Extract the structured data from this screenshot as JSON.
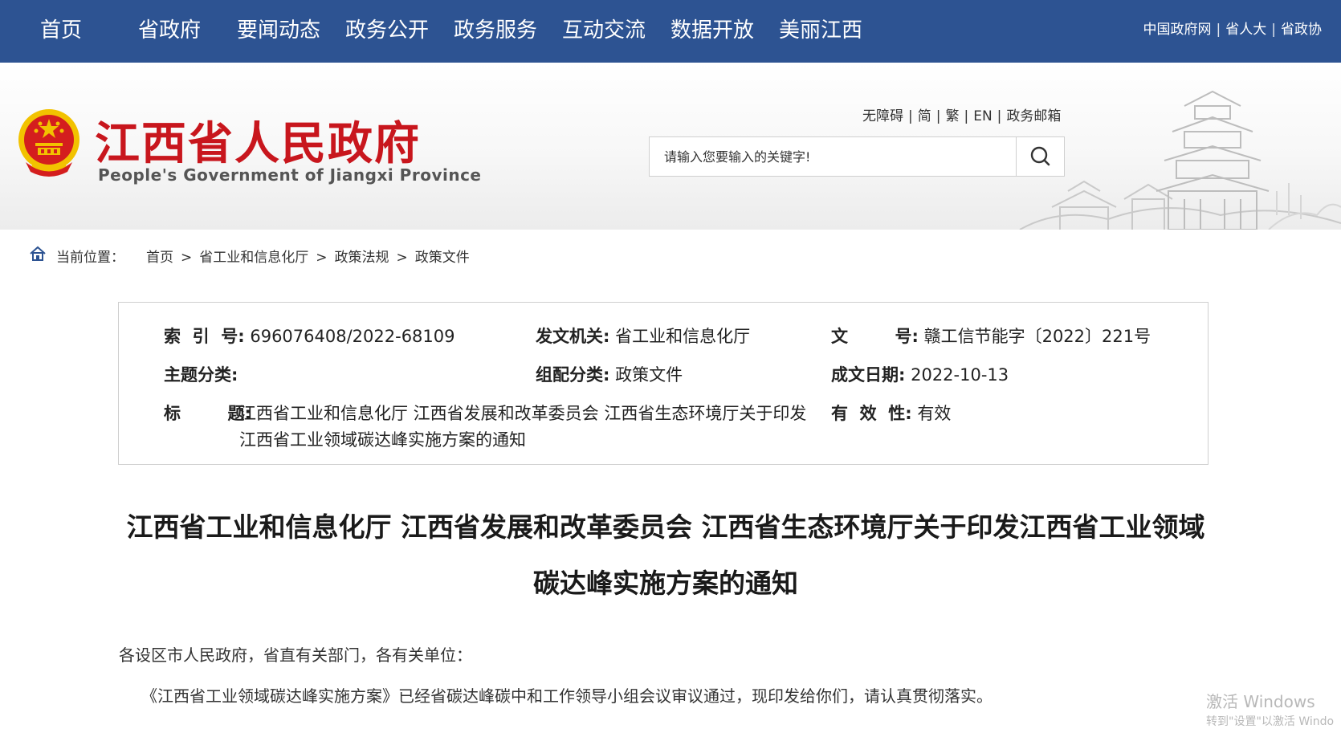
{
  "topnav": {
    "items": [
      {
        "label": "首页"
      },
      {
        "label": "省政府"
      },
      {
        "label": "要闻动态"
      },
      {
        "label": "政务公开"
      },
      {
        "label": "政务服务"
      },
      {
        "label": "互动交流"
      },
      {
        "label": "数据开放"
      },
      {
        "label": "美丽江西"
      }
    ],
    "external": [
      "中国政府网",
      "省人大",
      "省政协"
    ]
  },
  "header": {
    "title_cn": "江西省人民政府",
    "title_en": "People's Government of Jiangxi Province",
    "utility_links": [
      "无障碍",
      "简",
      "繁",
      "EN",
      "政务邮箱"
    ],
    "search_placeholder": "请输入您要输入的关键字!"
  },
  "breadcrumb": {
    "label": "当前位置：",
    "items": [
      "首页",
      "省工业和信息化厅",
      "政策法规",
      "政策文件"
    ],
    "separator": ">"
  },
  "meta": {
    "index_no_label": "索  引  号:",
    "index_no": "696076408/2022-68109",
    "issuer_label": "发文机关:",
    "issuer": "省工业和信息化厅",
    "doc_no_label": "文        号:",
    "doc_no": "赣工信节能字〔2022〕221号",
    "topic_label": "主题分类:",
    "topic": "",
    "category_label": "组配分类:",
    "category": "政策文件",
    "date_label": "成文日期:",
    "date": "2022-10-13",
    "title_label": "标        题:",
    "title": "江西省工业和信息化厅 江西省发展和改革委员会 江西省生态环境厅关于印发江西省工业领域碳达峰实施方案的通知",
    "validity_label": "有  效  性:",
    "validity": "有效"
  },
  "article": {
    "title": "江西省工业和信息化厅 江西省发展和改革委员会 江西省生态环境厅关于印发江西省工业领域碳达峰实施方案的通知",
    "salutation": "各设区市人民政府，省直有关部门，各有关单位：",
    "body": "《江西省工业领域碳达峰实施方案》已经省碳达峰碳中和工作领导小组会议审议通过，现印发给你们，请认真贯彻落实。"
  },
  "os_watermark": {
    "line1": "激活 Windows",
    "line2": "转到\"设置\"以激活 Windo"
  },
  "colors": {
    "nav_bg": "#2d5392",
    "brand_red": "#c8161d",
    "emblem_gold": "#f2c200"
  }
}
